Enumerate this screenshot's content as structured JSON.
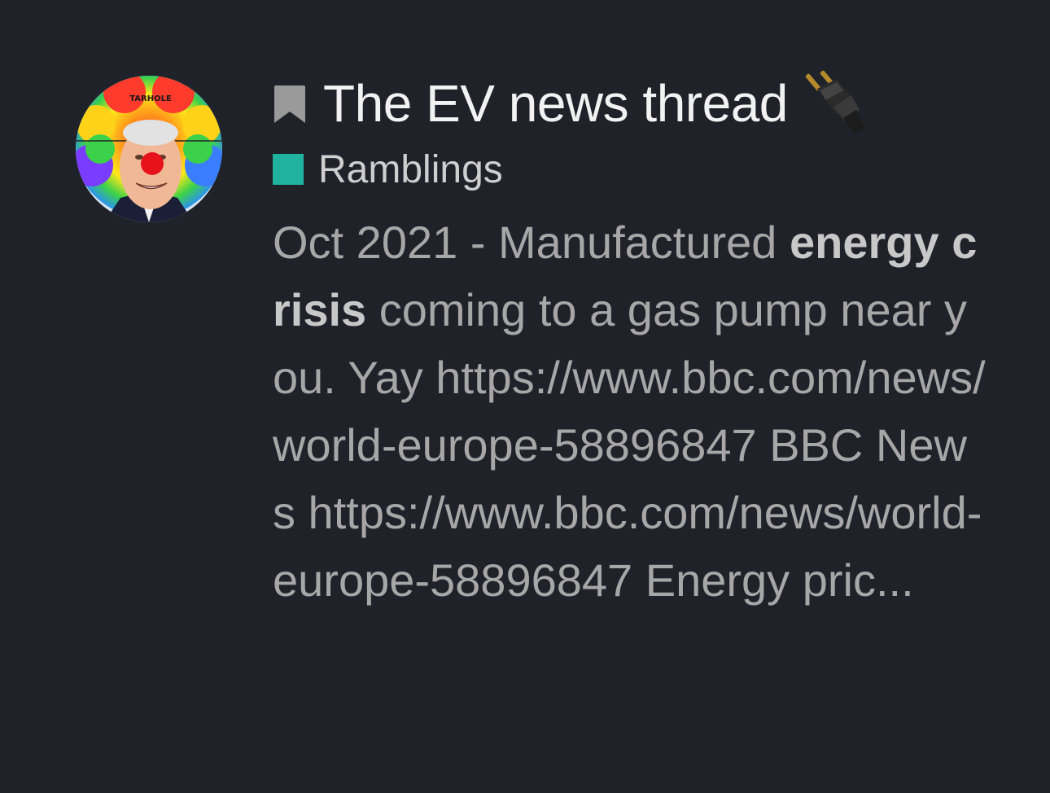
{
  "topic": {
    "title": "The EV news thread",
    "avatar_caption": "TARHOLE",
    "bookmark_icon": "bookmark-icon",
    "title_emoji_icon": "electric-plug-icon",
    "category": {
      "label": "Ramblings",
      "color": "#1fb29f"
    },
    "excerpt": {
      "before_highlight": "Oct 2021 - Manufactured ",
      "highlight": "energy crisis",
      "after_highlight": " coming to a gas pump near you. Yay https://www.bbc.com/news/world-europe-58896847 BBC News https://www.bbc.com/news/world-europe-58896847 Energy pric..."
    }
  },
  "colors": {
    "background": "#20222a",
    "title": "#f2f2f2",
    "excerpt": "#a7a7a7"
  }
}
